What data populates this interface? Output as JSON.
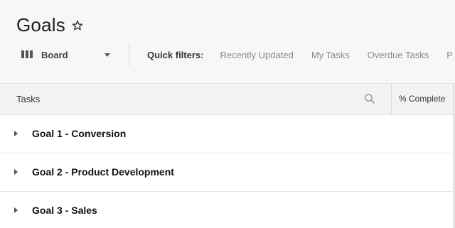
{
  "page": {
    "title": "Goals"
  },
  "toolbar": {
    "view_label": "Board",
    "quick_filters_label": "Quick filters:",
    "filters": [
      "Recently Updated",
      "My Tasks",
      "Overdue Tasks",
      "P"
    ]
  },
  "table": {
    "columns": {
      "tasks": "Tasks",
      "percent_complete": "% Complete"
    },
    "rows": [
      {
        "label": "Goal 1 - Conversion"
      },
      {
        "label": "Goal 2 - Product Development"
      },
      {
        "label": "Goal 3 - Sales"
      }
    ]
  },
  "icons": {
    "favorite": "star-outline-icon",
    "view": "board-columns-icon",
    "dropdown": "chevron-down-icon",
    "search": "search-icon",
    "row_expand": "caret-right-icon"
  }
}
